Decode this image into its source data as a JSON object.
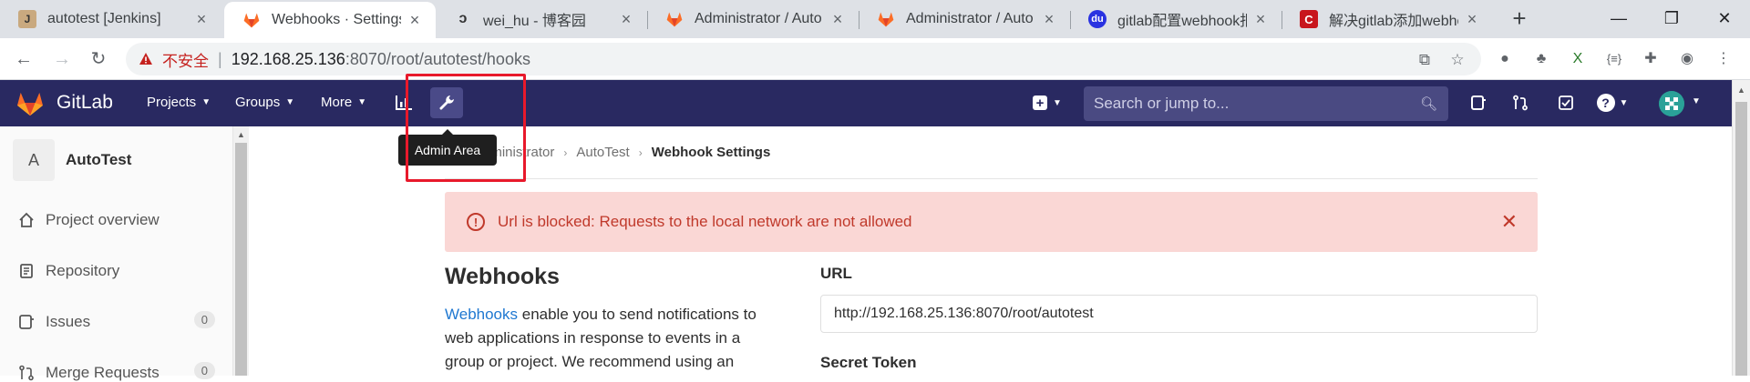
{
  "browser": {
    "tabs": [
      {
        "title": "autotest [Jenkins]",
        "icon": "jenkins-icon"
      },
      {
        "title": "Webhooks · Settings",
        "icon": "gitlab-icon"
      },
      {
        "title": "wei_hu - 博客园",
        "icon": "cnblogs-icon"
      },
      {
        "title": "Administrator / Auto",
        "icon": "gitlab-icon"
      },
      {
        "title": "Administrator / Auto",
        "icon": "gitlab-icon"
      },
      {
        "title": "gitlab配置webhook报",
        "icon": "baidu-icon"
      },
      {
        "title": "解决gitlab添加webho",
        "icon": "csdn-icon"
      }
    ],
    "address": {
      "security_label": "不安全",
      "host": "192.168.25.136",
      "path": ":8070/root/autotest/hooks"
    }
  },
  "gitlab": {
    "brand": "GitLab",
    "nav": {
      "projects": "Projects",
      "groups": "Groups",
      "more": "More"
    },
    "search_placeholder": "Search or jump to...",
    "tooltip": "Admin Area"
  },
  "sidebar": {
    "project_initial": "A",
    "project_name": "AutoTest",
    "items": [
      {
        "label": "Project overview",
        "icon": "home-icon"
      },
      {
        "label": "Repository",
        "icon": "doc-icon"
      },
      {
        "label": "Issues",
        "icon": "issues-icon",
        "count": "0"
      },
      {
        "label": "Merge Requests",
        "icon": "merge-request-icon",
        "count": "0"
      }
    ]
  },
  "breadcrumb": {
    "parent": "Administrator",
    "project": "AutoTest",
    "current": "Webhook Settings"
  },
  "alert": {
    "text": "Url is blocked: Requests to the local network are not allowed"
  },
  "webhooks": {
    "title": "Webhooks",
    "link_text": "Webhooks",
    "desc_rest": " enable you to send notifications to web applications in response to events in a group or project. We recommend using an",
    "url_label": "URL",
    "url_value": "http://192.168.25.136:8070/root/autotest",
    "secret_label": "Secret Token"
  },
  "colors": {
    "gitlab_header": "#292961",
    "alert_bg": "#fad7d5",
    "alert_text": "#c0392b",
    "highlight": "#e8192b",
    "link": "#1f78d1"
  }
}
